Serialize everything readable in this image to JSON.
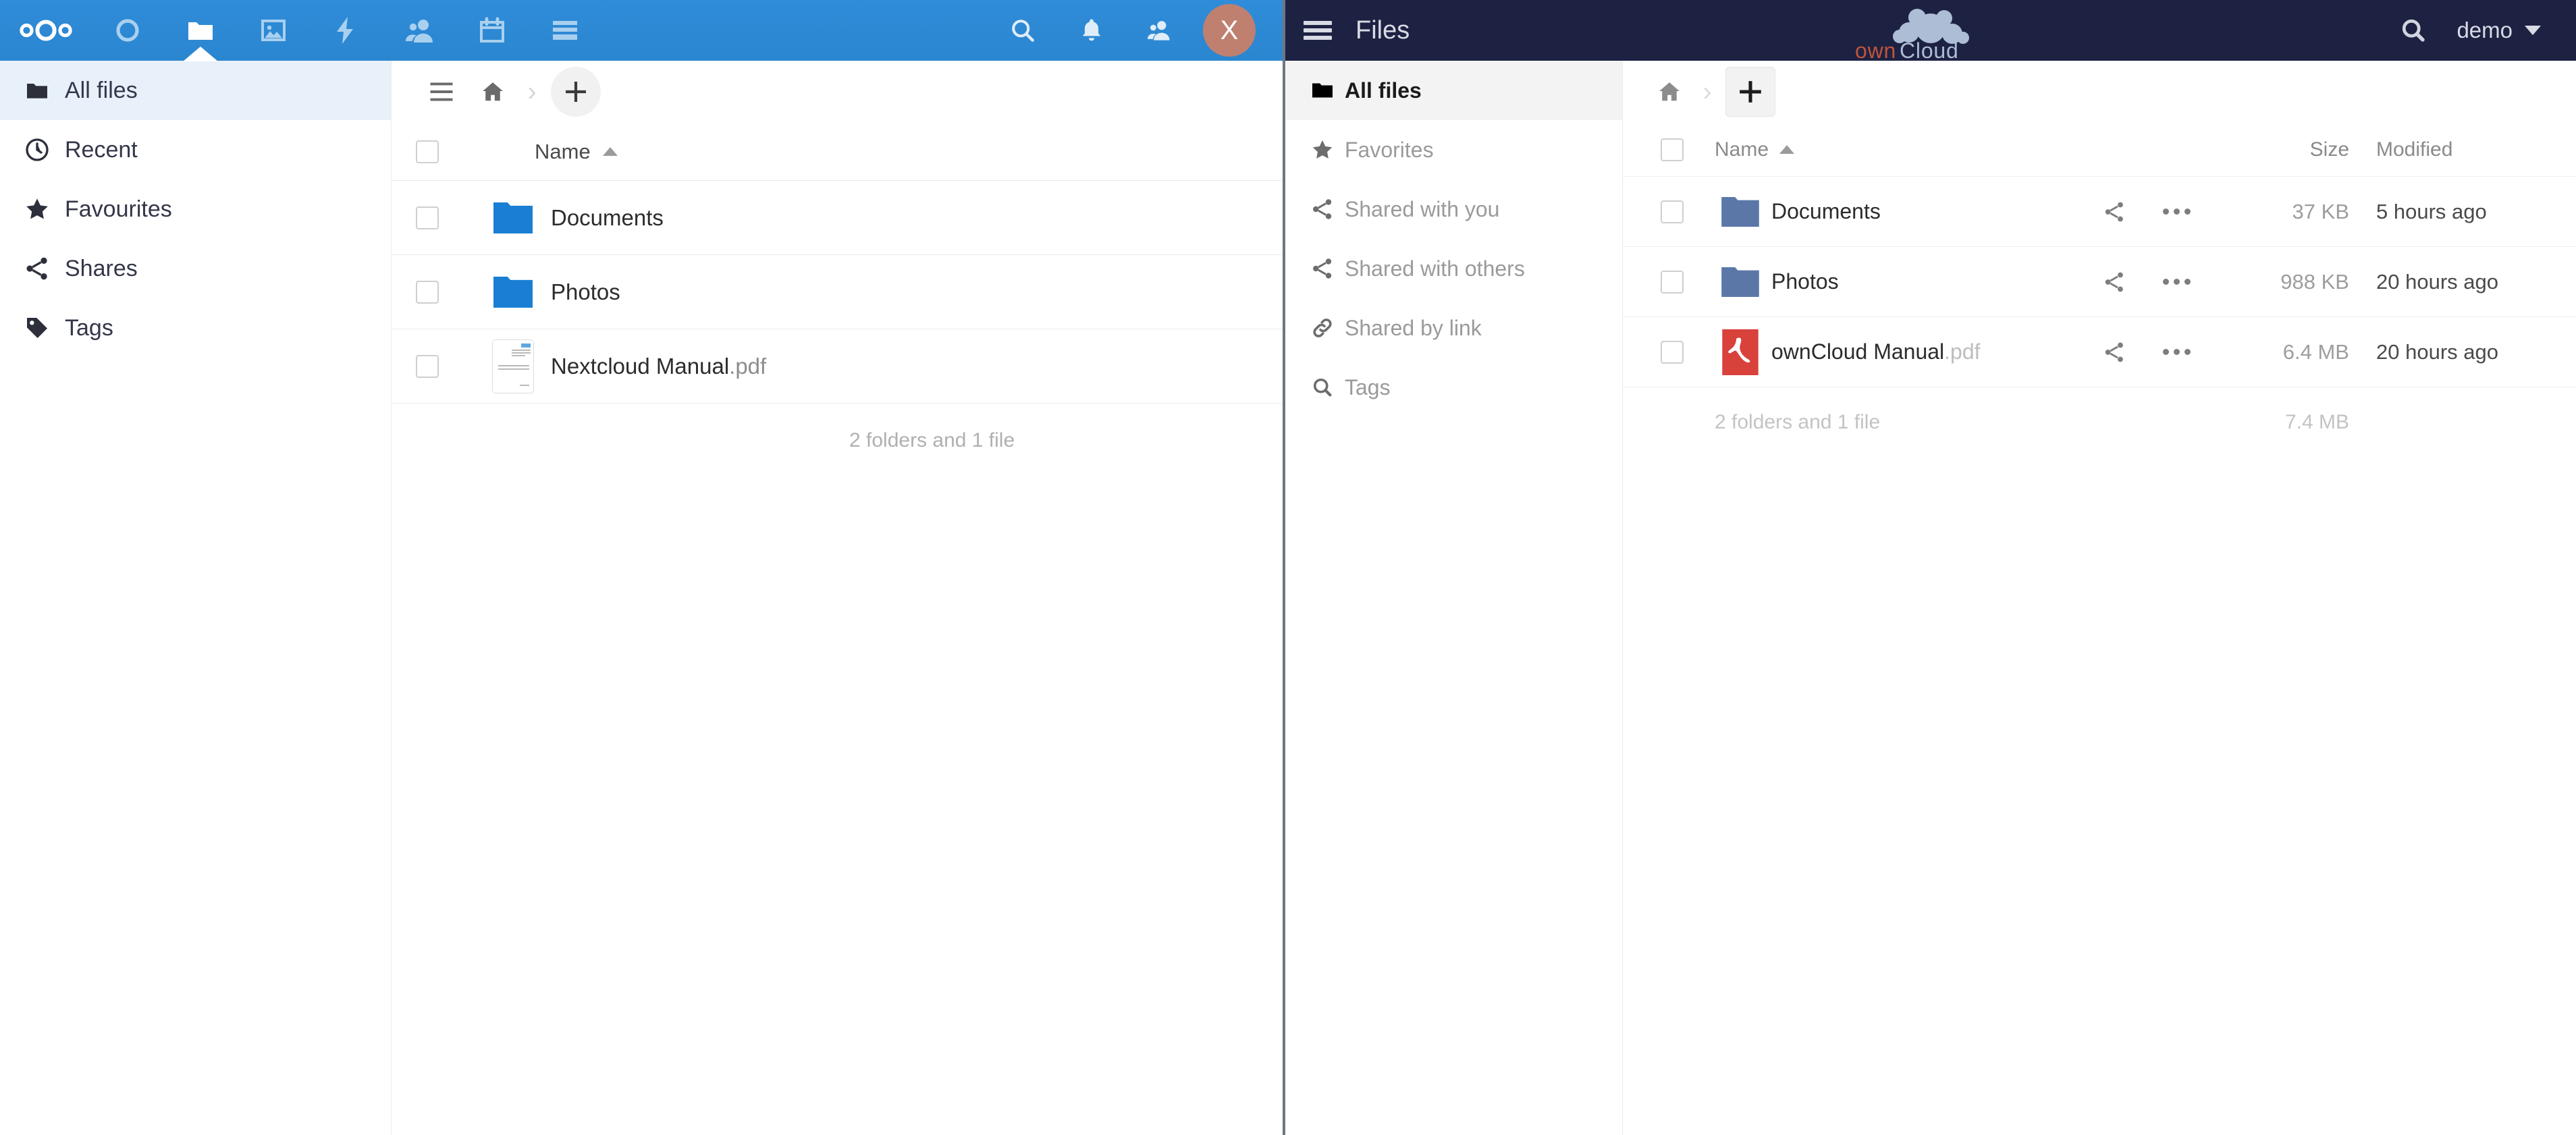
{
  "nextcloud": {
    "app_bar": {
      "logo_name": "nextcloud-logo",
      "apps": [
        {
          "name": "dashboard",
          "icon": "circle-icon",
          "active": false
        },
        {
          "name": "files",
          "icon": "folder-icon",
          "active": true
        },
        {
          "name": "photos",
          "icon": "image-icon",
          "active": false
        },
        {
          "name": "activity",
          "icon": "lightning-icon",
          "active": false
        },
        {
          "name": "contacts",
          "icon": "contacts-icon",
          "active": false
        },
        {
          "name": "calendar",
          "icon": "calendar-icon",
          "active": false
        },
        {
          "name": "deck",
          "icon": "deck-icon",
          "active": false
        }
      ],
      "right_icons": [
        {
          "name": "search",
          "icon": "magnifier-icon"
        },
        {
          "name": "notifications",
          "icon": "bell-icon"
        },
        {
          "name": "contacts-menu",
          "icon": "contacts-icon"
        }
      ],
      "avatar_initial": "X"
    },
    "sidebar": {
      "items": [
        {
          "label": "All files",
          "icon": "folder-icon",
          "active": true
        },
        {
          "label": "Recent",
          "icon": "clock-icon",
          "active": false
        },
        {
          "label": "Favourites",
          "icon": "star-icon",
          "active": false
        },
        {
          "label": "Shares",
          "icon": "share-icon",
          "active": false
        },
        {
          "label": "Tags",
          "icon": "tag-icon",
          "active": false
        }
      ]
    },
    "controls": {
      "toggle_label": "hamburger-icon",
      "home_label": "home-icon",
      "separator": "›",
      "new_label": "+"
    },
    "table": {
      "header_name": "Name",
      "sort_direction": "ascending",
      "rows": [
        {
          "name": "Documents",
          "ext": "",
          "type": "folder"
        },
        {
          "name": "Photos",
          "ext": "",
          "type": "folder"
        },
        {
          "name": "Nextcloud Manual",
          "ext": ".pdf",
          "type": "pdf"
        }
      ],
      "summary": "2 folders and 1 file"
    },
    "colors": {
      "accent": "#2e8ad6",
      "folder": "#1a7fd4",
      "avatar": "#c08070"
    }
  },
  "owncloud": {
    "header": {
      "menu_icon": "hamburger-icon",
      "title": "Files",
      "logo_own": "own",
      "logo_cloud": "Cloud",
      "search_icon": "magnifier-icon",
      "user": "demo"
    },
    "sidebar": {
      "items": [
        {
          "label": "All files",
          "icon": "folder-icon",
          "active": true
        },
        {
          "label": "Favorites",
          "icon": "star-icon",
          "active": false
        },
        {
          "label": "Shared with you",
          "icon": "share-icon",
          "active": false
        },
        {
          "label": "Shared with others",
          "icon": "share-icon",
          "active": false
        },
        {
          "label": "Shared by link",
          "icon": "link-icon",
          "active": false
        },
        {
          "label": "Tags",
          "icon": "magnifier-icon",
          "active": false
        }
      ]
    },
    "controls": {
      "home_label": "home-icon",
      "separator": "›",
      "new_label": "+"
    },
    "table": {
      "header_name": "Name",
      "header_size": "Size",
      "header_modified": "Modified",
      "sort_direction": "ascending",
      "rows": [
        {
          "name": "Documents",
          "ext": "",
          "type": "folder",
          "size": "37 KB",
          "modified": "5 hours ago"
        },
        {
          "name": "Photos",
          "ext": "",
          "type": "folder",
          "size": "988 KB",
          "modified": "20 hours ago"
        },
        {
          "name": "ownCloud Manual",
          "ext": ".pdf",
          "type": "pdf",
          "size": "6.4 MB",
          "modified": "20 hours ago"
        }
      ],
      "summary": "2 folders and 1 file",
      "total_size": "7.4 MB"
    },
    "colors": {
      "header": "#1d2243",
      "folder": "#5a77a8",
      "pdf": "#d9413b",
      "logo_own": "#c0543a"
    }
  }
}
